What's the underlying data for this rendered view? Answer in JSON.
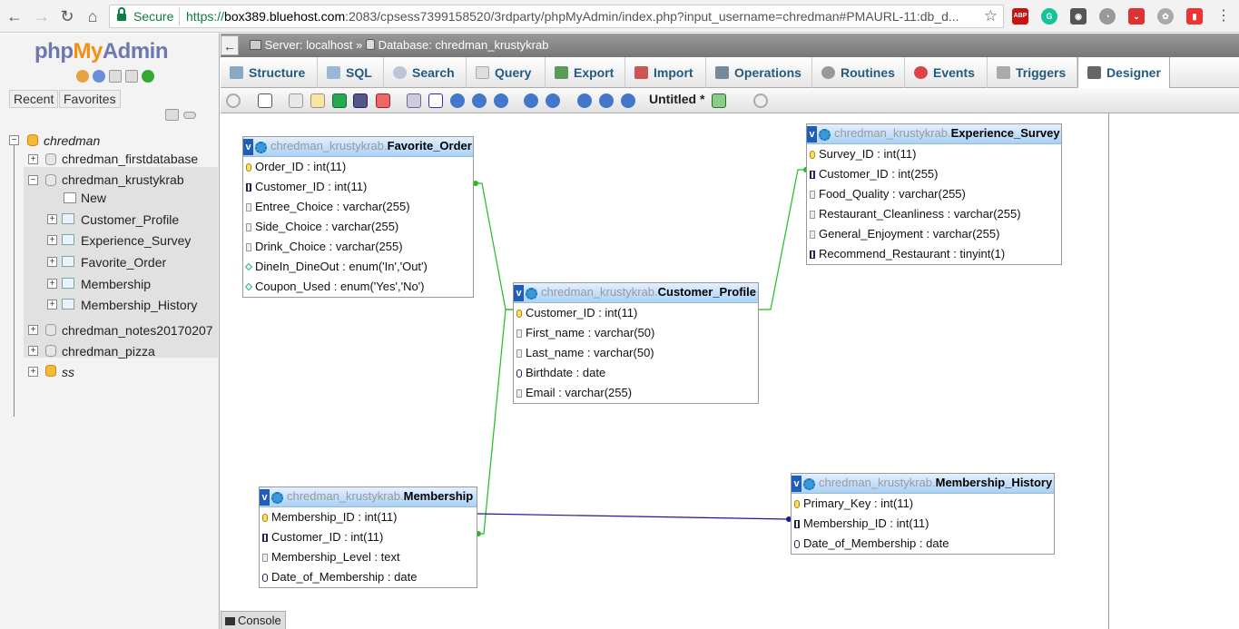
{
  "browser": {
    "secure_label": "Secure",
    "url_scheme": "https://",
    "url_host": "box389.bluehost.com",
    "url_rest": ":2083/cpsess7399158520/3rdparty/phpMyAdmin/index.php?input_username=chredman#PMAURL-11:db_d...",
    "extensions": [
      "ABP"
    ]
  },
  "sidebar": {
    "logo": {
      "php": "php",
      "my": "My",
      "admin": "Admin"
    },
    "tabs": {
      "recent": "Recent",
      "favorites": "Favorites"
    },
    "tree": {
      "root": "chredman",
      "databases": [
        "chredman_firstdatabase",
        "chredman_krustykrab",
        "chredman_notes20170207",
        "chredman_pizza"
      ],
      "ss": "ss",
      "krustykrab_children": [
        "New",
        "Customer_Profile",
        "Experience_Survey",
        "Favorite_Order",
        "Membership",
        "Membership_History"
      ]
    }
  },
  "header": {
    "collapse": "←",
    "server_label": "Server: localhost",
    "sep": "»",
    "database_label": "Database: chredman_krustykrab"
  },
  "tabs": [
    {
      "label": "Structure"
    },
    {
      "label": "SQL"
    },
    {
      "label": "Search"
    },
    {
      "label": "Query"
    },
    {
      "label": "Export"
    },
    {
      "label": "Import"
    },
    {
      "label": "Operations"
    },
    {
      "label": "Routines"
    },
    {
      "label": "Events"
    },
    {
      "label": "Triggers"
    },
    {
      "label": "Designer"
    }
  ],
  "designer": {
    "title": "Untitled *",
    "console": "Console",
    "db_prefix": "chredman_krustykrab.",
    "tables": {
      "favorite_order": {
        "name": "Favorite_Order",
        "columns": [
          "Order_ID : int(11)",
          "Customer_ID : int(11)",
          "Entree_Choice : varchar(255)",
          "Side_Choice : varchar(255)",
          "Drink_Choice : varchar(255)",
          "DineIn_DineOut : enum('In','Out')",
          "Coupon_Used : enum('Yes','No')"
        ]
      },
      "experience_survey": {
        "name": "Experience_Survey",
        "columns": [
          "Survey_ID : int(11)",
          "Customer_ID : int(255)",
          "Food_Quality : varchar(255)",
          "Restaurant_Cleanliness : varchar(255)",
          "General_Enjoyment : varchar(255)",
          "Recommend_Restaurant : tinyint(1)"
        ]
      },
      "customer_profile": {
        "name": "Customer_Profile",
        "columns": [
          "Customer_ID : int(11)",
          "First_name : varchar(50)",
          "Last_name : varchar(50)",
          "Birthdate : date",
          "Email : varchar(255)"
        ]
      },
      "membership": {
        "name": "Membership",
        "columns": [
          "Membership_ID : int(11)",
          "Customer_ID : int(11)",
          "Membership_Level : text",
          "Date_of_Membership : date"
        ]
      },
      "membership_history": {
        "name": "Membership_History",
        "columns": [
          "Primary_Key : int(11)",
          "Membership_ID : int(11)",
          "Date_of_Membership : date"
        ]
      }
    },
    "colors": {
      "rel_customer": "#22bb22",
      "rel_membership": "#1a1a99"
    }
  }
}
